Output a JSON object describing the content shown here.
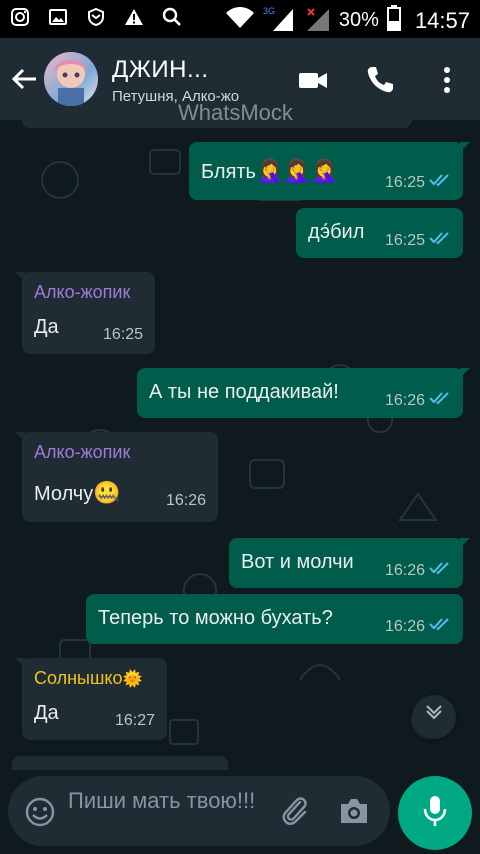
{
  "status_bar": {
    "battery_percent": "30%",
    "time": "14:57",
    "network": "3G"
  },
  "header": {
    "title": "ДЖИН...",
    "subtitle": "Петушня, Алко-жо",
    "watermark": "WhatsMock"
  },
  "messages": [
    {
      "direction": "out",
      "text": "Блять",
      "emoji": "🤦‍♀️🤦‍♀️🤦‍♀️",
      "time": "16:25",
      "ticks": "read"
    },
    {
      "direction": "out",
      "text": "дэ́бил",
      "time": "16:25",
      "ticks": "read"
    },
    {
      "direction": "in",
      "sender": "Алко-жопик",
      "sender_color": "#a07ad6",
      "text": "Да",
      "time": "16:25"
    },
    {
      "direction": "out",
      "text": "А ты не поддакивай!",
      "time": "16:26",
      "ticks": "read"
    },
    {
      "direction": "in",
      "sender": "Алко-жопик",
      "sender_color": "#a07ad6",
      "text": "Молчу",
      "emoji": "🤐",
      "time": "16:26"
    },
    {
      "direction": "out",
      "text": "Вот и молчи",
      "time": "16:26",
      "ticks": "read"
    },
    {
      "direction": "out",
      "text": "Теперь то можно бухать?",
      "time": "16:26",
      "ticks": "read"
    },
    {
      "direction": "in",
      "sender": "Солнышко",
      "sender_emoji": "🌞",
      "sender_color": "#f2c21b",
      "text": "Да",
      "time": "16:27"
    }
  ],
  "input": {
    "placeholder": "Пиши мать твою!!!"
  },
  "colors": {
    "outgoing_bubble": "#005c4b",
    "incoming_bubble": "#1f2c34",
    "tick_read": "#53bdeb",
    "accent": "#00a884"
  },
  "icons": {
    "back": "arrow-left-icon",
    "video": "video-call-icon",
    "call": "phone-icon",
    "menu": "more-vert-icon",
    "emoji": "emoji-icon",
    "attach": "paperclip-icon",
    "camera": "camera-icon",
    "mic": "microphone-icon",
    "scroll": "chevron-down-icon"
  }
}
